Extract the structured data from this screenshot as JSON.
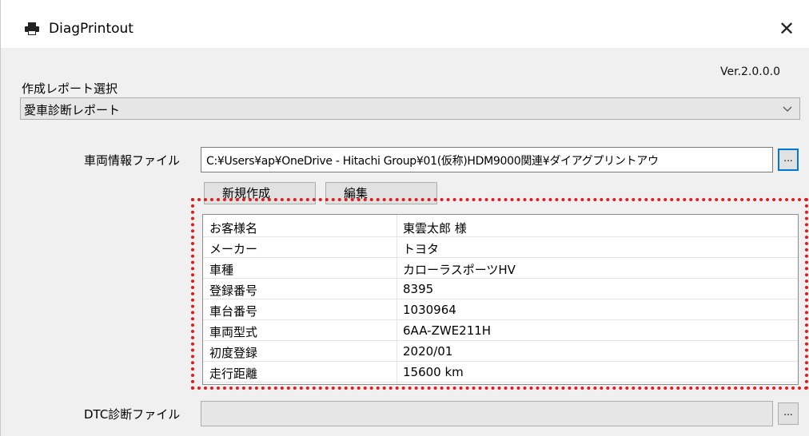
{
  "window": {
    "title": "DiagPrintout",
    "close_glyph": "✕",
    "icon": "printer-icon"
  },
  "version": "Ver.2.0.0.0",
  "report": {
    "label": "作成レポート選択",
    "selected": "愛車診断レポート"
  },
  "vehicle_file": {
    "label": "車両情報ファイル",
    "path": "C:¥Users¥ap¥OneDrive - Hitachi Group¥01(仮称)HDM9000関連¥ダイアグプリントアウ",
    "browse_label": "..."
  },
  "buttons": {
    "new_label": "新規作成",
    "edit_label": "編集"
  },
  "vehicle_info": [
    {
      "key": "お客様名",
      "value": "東雲太郎 様"
    },
    {
      "key": "メーカー",
      "value": "トヨタ"
    },
    {
      "key": "車種",
      "value": "カローラスポーツHV"
    },
    {
      "key": "登録番号",
      "value": "8395"
    },
    {
      "key": "車台番号",
      "value": "1030964"
    },
    {
      "key": "車両型式",
      "value": "6AA-ZWE211H"
    },
    {
      "key": "初度登録",
      "value": "2020/01"
    },
    {
      "key": "走行距離",
      "value": "15600 km"
    }
  ],
  "dtc_file": {
    "label": "DTC診断ファイル",
    "path": "",
    "browse_label": "..."
  },
  "colors": {
    "highlight": "#e11b1b",
    "accent": "#0078d7"
  }
}
